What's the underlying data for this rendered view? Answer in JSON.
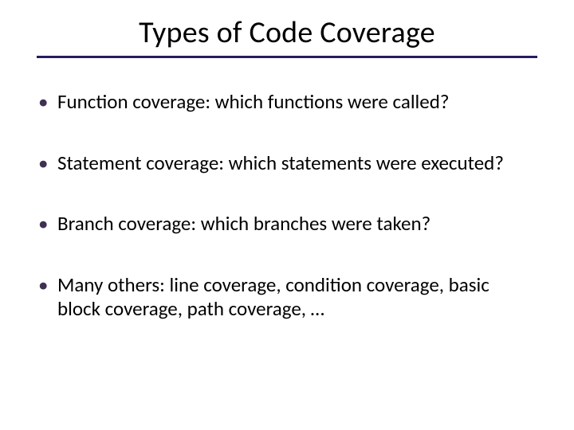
{
  "title": "Types of Code Coverage",
  "bullets": [
    "Function coverage: which functions were called?",
    "Statement coverage: which statements were executed?",
    "Branch coverage: which branches were taken?",
    "Many others: line coverage, condition coverage, basic block coverage, path coverage, …"
  ]
}
